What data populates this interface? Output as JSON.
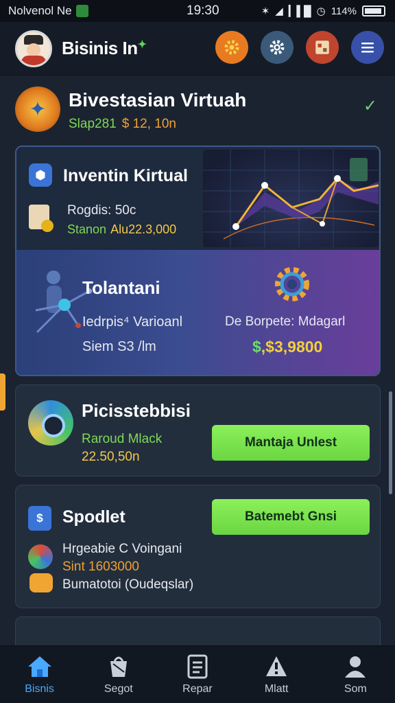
{
  "status": {
    "left_text": "Nolvenol Ne",
    "time": "19:30",
    "battery": "114%"
  },
  "header": {
    "title": "Bisinis In",
    "actions": [
      {
        "icon": "gear-icon",
        "color": "#e87a22"
      },
      {
        "icon": "settings-icon",
        "color": "#3b5a7a"
      },
      {
        "icon": "profile-card-icon",
        "color": "#c0442e"
      },
      {
        "icon": "menu-icon",
        "color": "#3850a8"
      }
    ]
  },
  "section": {
    "title": "Bivestasian Virtuah",
    "sub_green": "Slap281",
    "sub_orange": "$ 12, 10n"
  },
  "investment_card": {
    "title": "Inventin Kirtual",
    "line1": "Rogdis: 50c",
    "line2_green": "Stanon",
    "line2_yellow": "Alu22.3,000"
  },
  "tolantani": {
    "title": "Tolantani",
    "left_line1": "Iedrpis⁴ Varioanl",
    "left_line2": "Siem S3 /lm",
    "right_line1": "De Borpete: Mdagarl",
    "right_dollar": "$",
    "right_value": ",$3,9800"
  },
  "card_picks": {
    "title": "Picisstebbisi",
    "line1": "Raroud Mlack",
    "line2": "22.50,50n",
    "button": "Mantaja Unlest"
  },
  "card_spodlet": {
    "title": "Spodlet",
    "button": "Batemebt Gnsi",
    "line1": "Hrgeabie C Voingani",
    "line2": "Sint 1603000",
    "line3": "Bumatotoi (Oudeqslar)"
  },
  "bottom_nav": [
    {
      "label": "Bisnis",
      "icon": "home-icon"
    },
    {
      "label": "Segot",
      "icon": "bag-icon"
    },
    {
      "label": "Repar",
      "icon": "document-icon"
    },
    {
      "label": "Mlatt",
      "icon": "alert-icon"
    },
    {
      "label": "Som",
      "icon": "user-icon"
    }
  ]
}
